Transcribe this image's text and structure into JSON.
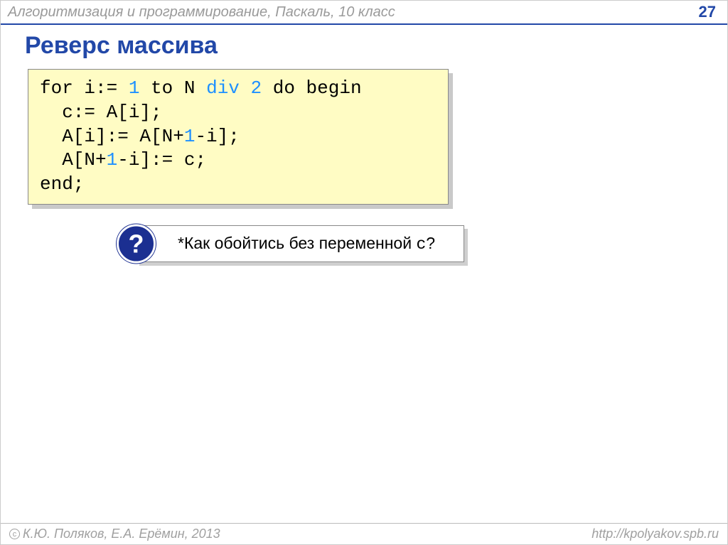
{
  "header": {
    "breadcrumb": "Алгоритмизация и программирование, Паскаль, 10 класс",
    "page_number": "27"
  },
  "title": "Реверс массива",
  "code": {
    "tokens": [
      [
        {
          "t": "for ",
          "c": "kw"
        },
        {
          "t": "i:= ",
          "c": ""
        },
        {
          "t": "1",
          "c": "num"
        },
        {
          "t": " to ",
          "c": "kw"
        },
        {
          "t": "N ",
          "c": ""
        },
        {
          "t": "div",
          "c": "op"
        },
        {
          "t": " ",
          "c": ""
        },
        {
          "t": "2",
          "c": "num"
        },
        {
          "t": " do begin",
          "c": "kw"
        }
      ],
      [
        {
          "t": "  c:= A[i];",
          "c": ""
        }
      ],
      [
        {
          "t": "  A[i]:= A[N+",
          "c": ""
        },
        {
          "t": "1",
          "c": "num"
        },
        {
          "t": "-i];",
          "c": ""
        }
      ],
      [
        {
          "t": "  A[N+",
          "c": ""
        },
        {
          "t": "1",
          "c": "num"
        },
        {
          "t": "-i]:= c;",
          "c": ""
        }
      ],
      [
        {
          "t": "end;",
          "c": "kw"
        }
      ]
    ]
  },
  "hint": {
    "icon_char": "?",
    "text_prefix": "*Как обойтись без переменной ",
    "var": "c",
    "text_suffix": "?"
  },
  "footer": {
    "copyright_symbol": "c",
    "authors": " К.Ю. Поляков, Е.А. Ерёмин, 2013",
    "url": "http://kpolyakov.spb.ru"
  }
}
